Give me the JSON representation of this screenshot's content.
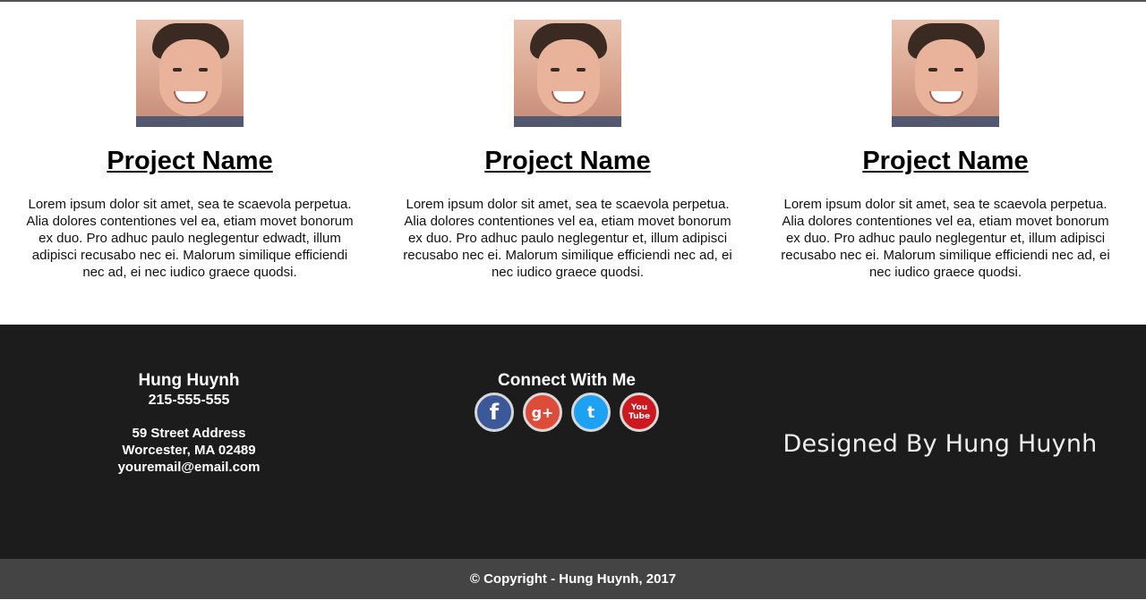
{
  "projects": [
    {
      "title": "Project Name",
      "description": "Lorem ipsum dolor sit amet, sea te scaevola perpetua. Alia dolores contentiones vel ea, etiam movet bonorum ex duo. Pro adhuc paulo neglegentur edwadt, illum adipisci recusabo nec ei. Malorum similique efficiendi nec ad, ei nec iudico graece quodsi."
    },
    {
      "title": "Project Name",
      "description": "Lorem ipsum dolor sit amet, sea te scaevola perpetua. Alia dolores contentiones vel ea, etiam movet bonorum ex duo. Pro adhuc paulo neglegentur et, illum adipisci recusabo nec ei. Malorum similique efficiendi nec ad, ei nec iudico graece quodsi."
    },
    {
      "title": "Project Name",
      "description": "Lorem ipsum dolor sit amet, sea te scaevola perpetua. Alia dolores contentiones vel ea, etiam movet bonorum ex duo. Pro adhuc paulo neglegentur et, illum adipisci recusabo nec ei. Malorum similique efficiendi nec ad, ei nec iudico graece quodsi."
    }
  ],
  "contact": {
    "name": "Hung Huynh",
    "phone": "215-555-555",
    "street": "59 Street Address",
    "city": "Worcester, MA 02489",
    "email": "youremail@email.com"
  },
  "connect": {
    "title": "Connect With Me",
    "icons": [
      {
        "name": "facebook-icon",
        "glyph": "f",
        "color": "#3b5998"
      },
      {
        "name": "google-plus-icon",
        "glyph": "g+",
        "color": "#dd4b39"
      },
      {
        "name": "twitter-icon",
        "glyph": "t",
        "color": "#1da1f2"
      },
      {
        "name": "youtube-icon",
        "glyph": "You Tube",
        "color": "#cc181e"
      }
    ]
  },
  "designed_by": "Designed By Hung Huynh",
  "copyright": "© Copyright - Hung Huynh, 2017",
  "colors": {
    "footer_bg": "#1c1c1c",
    "copyright_bg": "#444444"
  }
}
